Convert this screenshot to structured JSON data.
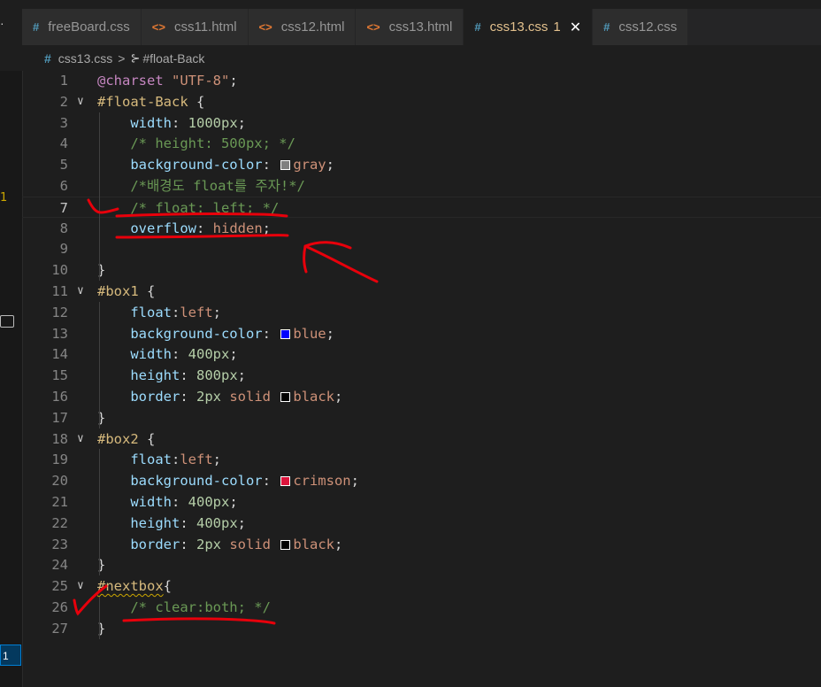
{
  "sidebar": {
    "top_glyph": "·",
    "badge": "1",
    "status_badge": "1"
  },
  "tabs": [
    {
      "label": "freeBoard.css",
      "icon": "#",
      "icon_kind": "css",
      "active": false
    },
    {
      "label": "css11.html",
      "icon": "<>",
      "icon_kind": "html",
      "active": false
    },
    {
      "label": "css12.html",
      "icon": "<>",
      "icon_kind": "html",
      "active": false
    },
    {
      "label": "css13.html",
      "icon": "<>",
      "icon_kind": "html",
      "active": false
    },
    {
      "label": "css13.css",
      "icon": "#",
      "icon_kind": "css",
      "active": true,
      "problems": "1",
      "close": "✕"
    },
    {
      "label": "css12.css",
      "icon": "#",
      "icon_kind": "css",
      "active": false
    }
  ],
  "breadcrumb": {
    "file_icon": "#",
    "file": "css13.css",
    "separator": ">",
    "symbol_icon": "⊱",
    "symbol": "#float-Back"
  },
  "colors": {
    "gray": "#808080",
    "blue": "#0000ff",
    "black": "#000000",
    "crimson": "#dc143c",
    "annotation": "#e8000b"
  },
  "editor": {
    "lines": [
      {
        "n": "1",
        "tokens": [
          [
            "at",
            "@charset"
          ],
          [
            "pun",
            " "
          ],
          [
            "str",
            "\"UTF-8\""
          ],
          [
            "pun",
            ";"
          ]
        ]
      },
      {
        "n": "2",
        "fold": "∨",
        "tokens": [
          [
            "sel",
            "#float-Back"
          ],
          [
            "pun",
            " {"
          ]
        ]
      },
      {
        "n": "3",
        "indent": true,
        "tokens": [
          [
            "prop",
            "width"
          ],
          [
            "pun",
            ": "
          ],
          [
            "num",
            "1000px"
          ],
          [
            "pun",
            ";"
          ]
        ]
      },
      {
        "n": "4",
        "indent": true,
        "tokens": [
          [
            "cmt",
            "/* height: 500px; */"
          ]
        ]
      },
      {
        "n": "5",
        "indent": true,
        "tokens": [
          [
            "prop",
            "background-color"
          ],
          [
            "pun",
            ": "
          ],
          [
            "swatch",
            "gray"
          ],
          [
            "val",
            "gray"
          ],
          [
            "pun",
            ";"
          ]
        ]
      },
      {
        "n": "6",
        "indent": true,
        "tokens": [
          [
            "cmt",
            "/*배경도 float를 주자!*/"
          ]
        ]
      },
      {
        "n": "7",
        "indent": true,
        "current": true,
        "tokens": [
          [
            "cmt",
            "/* float: left; */"
          ]
        ]
      },
      {
        "n": "8",
        "indent": true,
        "tokens": [
          [
            "prop",
            "overflow"
          ],
          [
            "pun",
            ": "
          ],
          [
            "val",
            "hidden"
          ],
          [
            "pun",
            ";"
          ]
        ]
      },
      {
        "n": "9",
        "indent": true,
        "tokens": []
      },
      {
        "n": "10",
        "tokens": [
          [
            "pun",
            "}"
          ]
        ]
      },
      {
        "n": "11",
        "fold": "∨",
        "tokens": [
          [
            "sel",
            "#box1"
          ],
          [
            "pun",
            " {"
          ]
        ]
      },
      {
        "n": "12",
        "indent": true,
        "tokens": [
          [
            "prop",
            "float"
          ],
          [
            "pun",
            ":"
          ],
          [
            "val",
            "left"
          ],
          [
            "pun",
            ";"
          ]
        ]
      },
      {
        "n": "13",
        "indent": true,
        "tokens": [
          [
            "prop",
            "background-color"
          ],
          [
            "pun",
            ": "
          ],
          [
            "swatch",
            "blue"
          ],
          [
            "val",
            "blue"
          ],
          [
            "pun",
            ";"
          ]
        ]
      },
      {
        "n": "14",
        "indent": true,
        "tokens": [
          [
            "prop",
            "width"
          ],
          [
            "pun",
            ": "
          ],
          [
            "num",
            "400px"
          ],
          [
            "pun",
            ";"
          ]
        ]
      },
      {
        "n": "15",
        "indent": true,
        "tokens": [
          [
            "prop",
            "height"
          ],
          [
            "pun",
            ": "
          ],
          [
            "num",
            "800px"
          ],
          [
            "pun",
            ";"
          ]
        ]
      },
      {
        "n": "16",
        "indent": true,
        "tokens": [
          [
            "prop",
            "border"
          ],
          [
            "pun",
            ": "
          ],
          [
            "num",
            "2px"
          ],
          [
            "pun",
            " "
          ],
          [
            "val",
            "solid"
          ],
          [
            "pun",
            " "
          ],
          [
            "swatch",
            "black"
          ],
          [
            "val",
            "black"
          ],
          [
            "pun",
            ";"
          ]
        ]
      },
      {
        "n": "17",
        "tokens": [
          [
            "pun",
            "}"
          ]
        ]
      },
      {
        "n": "18",
        "fold": "∨",
        "tokens": [
          [
            "sel",
            "#box2"
          ],
          [
            "pun",
            " {"
          ]
        ]
      },
      {
        "n": "19",
        "indent": true,
        "tokens": [
          [
            "prop",
            "float"
          ],
          [
            "pun",
            ":"
          ],
          [
            "val",
            "left"
          ],
          [
            "pun",
            ";"
          ]
        ]
      },
      {
        "n": "20",
        "indent": true,
        "tokens": [
          [
            "prop",
            "background-color"
          ],
          [
            "pun",
            ": "
          ],
          [
            "swatch",
            "crimson"
          ],
          [
            "val",
            "crimson"
          ],
          [
            "pun",
            ";"
          ]
        ]
      },
      {
        "n": "21",
        "indent": true,
        "tokens": [
          [
            "prop",
            "width"
          ],
          [
            "pun",
            ": "
          ],
          [
            "num",
            "400px"
          ],
          [
            "pun",
            ";"
          ]
        ]
      },
      {
        "n": "22",
        "indent": true,
        "tokens": [
          [
            "prop",
            "height"
          ],
          [
            "pun",
            ": "
          ],
          [
            "num",
            "400px"
          ],
          [
            "pun",
            ";"
          ]
        ]
      },
      {
        "n": "23",
        "indent": true,
        "tokens": [
          [
            "prop",
            "border"
          ],
          [
            "pun",
            ": "
          ],
          [
            "num",
            "2px"
          ],
          [
            "pun",
            " "
          ],
          [
            "val",
            "solid"
          ],
          [
            "pun",
            " "
          ],
          [
            "swatch",
            "black"
          ],
          [
            "val",
            "black"
          ],
          [
            "pun",
            ";"
          ]
        ]
      },
      {
        "n": "24",
        "tokens": [
          [
            "pun",
            "}"
          ]
        ]
      },
      {
        "n": "25",
        "fold": "∨",
        "tokens": [
          [
            "sel-squiggle",
            "#nextbox"
          ],
          [
            "pun",
            "{"
          ]
        ]
      },
      {
        "n": "26",
        "indent": true,
        "tokens": [
          [
            "cmt",
            "/* clear:both; */"
          ]
        ]
      },
      {
        "n": "27",
        "tokens": [
          [
            "pun",
            "}"
          ]
        ]
      }
    ]
  }
}
